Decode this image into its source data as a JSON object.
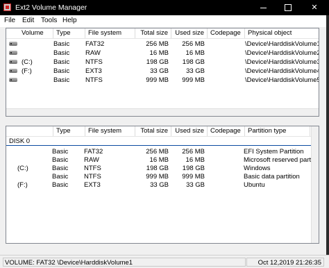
{
  "window": {
    "title": "Ext2 Volume Manager",
    "controls": {
      "minimize": "",
      "maximize": "",
      "close": "✕"
    }
  },
  "menu": [
    "File",
    "Edit",
    "Tools",
    "Help"
  ],
  "volumes_table": {
    "headers": [
      "Volume",
      "Type",
      "File system",
      "Total size",
      "Used size",
      "Codepage",
      "Physical object"
    ],
    "rows": [
      {
        "volume": "",
        "type": "Basic",
        "fs": "FAT32",
        "total": "256 MB",
        "used": "256 MB",
        "codepage": "",
        "object": "\\Device\\HarddiskVolume1"
      },
      {
        "volume": "",
        "type": "Basic",
        "fs": "RAW",
        "total": "16 MB",
        "used": "16 MB",
        "codepage": "",
        "object": "\\Device\\HarddiskVolume2"
      },
      {
        "volume": "(C:)",
        "type": "Basic",
        "fs": "NTFS",
        "total": "198 GB",
        "used": "198 GB",
        "codepage": "",
        "object": "\\Device\\HarddiskVolume3"
      },
      {
        "volume": "(F:)",
        "type": "Basic",
        "fs": "EXT3",
        "total": "33 GB",
        "used": "33 GB",
        "codepage": "",
        "object": "\\Device\\HarddiskVolume4"
      },
      {
        "volume": "",
        "type": "Basic",
        "fs": "NTFS",
        "total": "999 MB",
        "used": "999 MB",
        "codepage": "",
        "object": "\\Device\\HarddiskVolume5"
      }
    ]
  },
  "partitions_table": {
    "headers": [
      "",
      "Type",
      "File system",
      "Total size",
      "Used size",
      "Codepage",
      "Partition type"
    ],
    "disk_label": "DISK 0",
    "rows": [
      {
        "volume": "",
        "type": "Basic",
        "fs": "FAT32",
        "total": "256 MB",
        "used": "256 MB",
        "codepage": "",
        "ptype": "EFI System Partition"
      },
      {
        "volume": "",
        "type": "Basic",
        "fs": "RAW",
        "total": "16 MB",
        "used": "16 MB",
        "codepage": "",
        "ptype": "Microsoft reserved partiti"
      },
      {
        "volume": "(C:)",
        "type": "Basic",
        "fs": "NTFS",
        "total": "198 GB",
        "used": "198 GB",
        "codepage": "",
        "ptype": "Windows"
      },
      {
        "volume": "",
        "type": "Basic",
        "fs": "NTFS",
        "total": "999 MB",
        "used": "999 MB",
        "codepage": "",
        "ptype": "Basic data partition"
      },
      {
        "volume": "(F:)",
        "type": "Basic",
        "fs": "EXT3",
        "total": "33 GB",
        "used": "33 GB",
        "codepage": "",
        "ptype": "Ubuntu"
      }
    ]
  },
  "status": {
    "left": "VOLUME:  FAT32 \\Device\\HarddiskVolume1",
    "right": "Oct 12,2019 21:26:35"
  }
}
